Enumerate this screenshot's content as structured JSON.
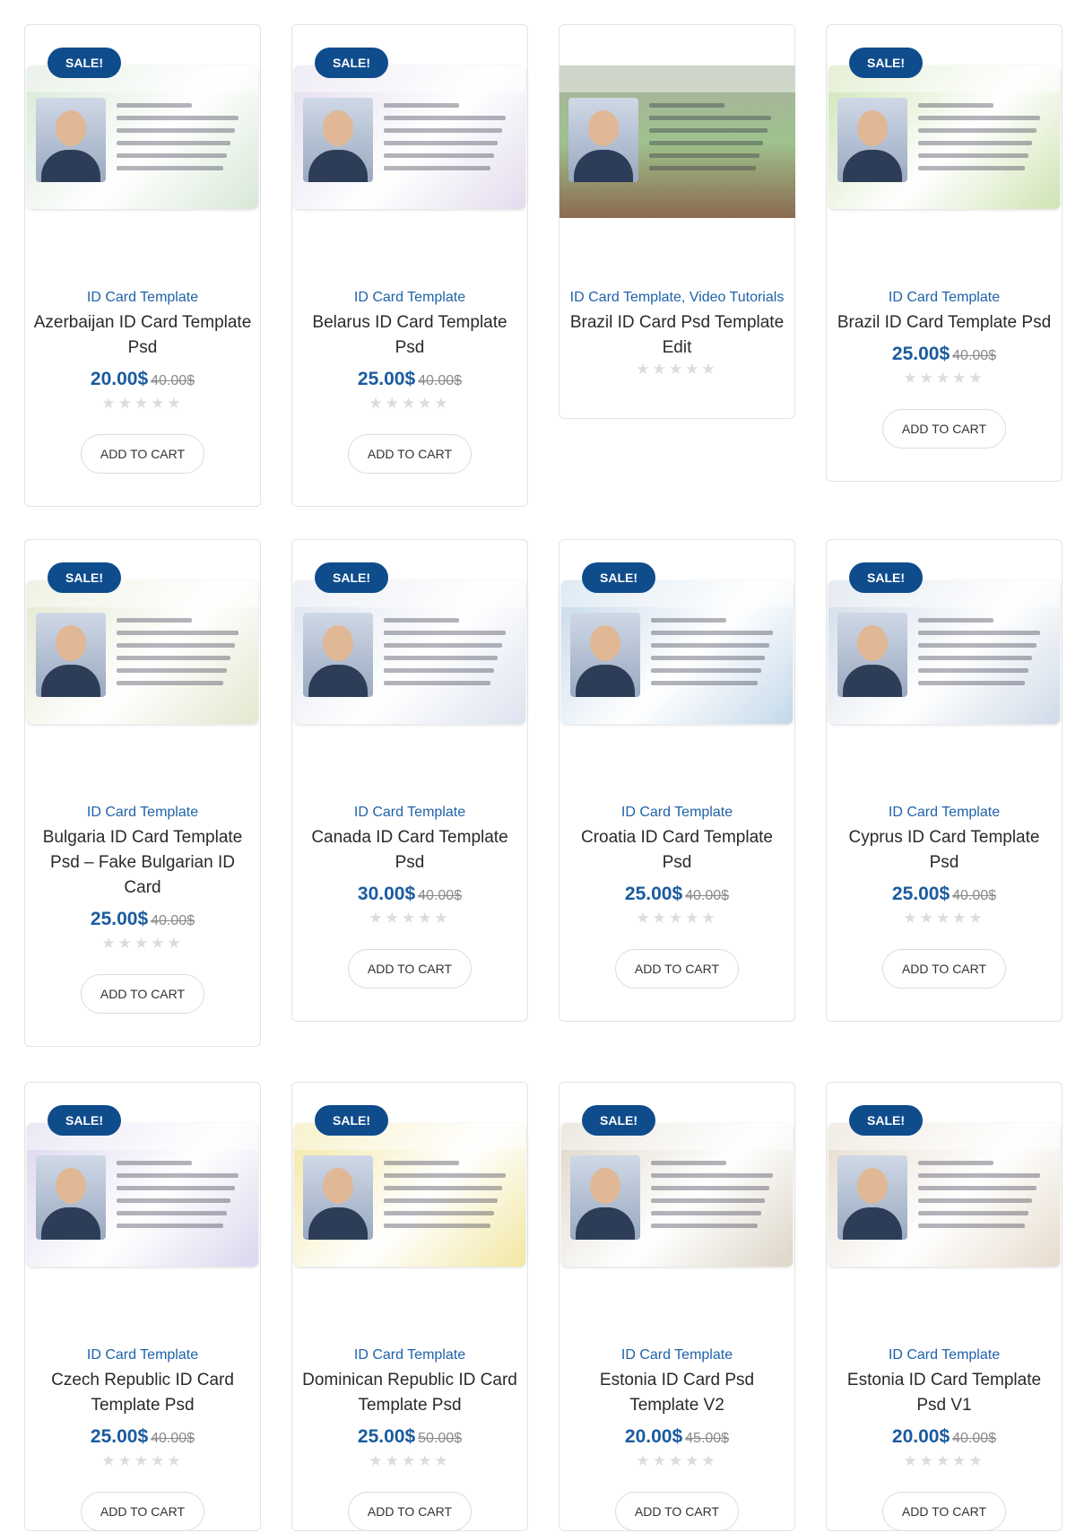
{
  "products": [
    {
      "sale": "SALE!",
      "image": "azerbaijan-id-card-image",
      "category": "ID Card Template",
      "title": "Azerbaijan ID Card Template Psd",
      "price": "20.00$",
      "old_price": "40.00$",
      "rating": 0,
      "button": "ADD TO CART",
      "tint": "#d7e8d6"
    },
    {
      "sale": "SALE!",
      "image": "belarus-id-card-image",
      "category": "ID Card Template",
      "title": "Belarus ID Card Template Psd",
      "price": "25.00$",
      "old_price": "40.00$",
      "rating": 0,
      "button": "ADD TO CART",
      "tint": "#e3dcee"
    },
    {
      "sale": "",
      "image": "brazil-id-card-photo-image",
      "category": "ID Card Template, Video Tutorials",
      "title": "Brazil ID Card Psd Template Edit",
      "price": "",
      "old_price": "",
      "rating": 0,
      "button": "",
      "tint": "#9fc28e"
    },
    {
      "sale": "SALE!",
      "image": "brazil-id-card-image",
      "category": "ID Card Template",
      "title": "Brazil ID Card Template Psd",
      "price": "25.00$",
      "old_price": "40.00$",
      "rating": 0,
      "button": "ADD TO CART",
      "tint": "#cfe4b3"
    },
    {
      "sale": "SALE!",
      "image": "bulgaria-id-card-image",
      "category": "ID Card Template",
      "title": "Bulgaria ID Card Template Psd – Fake Bulgarian ID Card",
      "price": "25.00$",
      "old_price": "40.00$",
      "rating": 0,
      "button": "ADD TO CART",
      "tint": "#e4e7cf"
    },
    {
      "sale": "SALE!",
      "image": "canada-id-card-image",
      "category": "ID Card Template",
      "title": "Canada ID Card Template Psd",
      "price": "30.00$",
      "old_price": "40.00$",
      "rating": 0,
      "button": "ADD TO CART",
      "tint": "#dde3ef"
    },
    {
      "sale": "SALE!",
      "image": "croatia-id-card-image",
      "category": "ID Card Template",
      "title": "Croatia ID Card Template Psd",
      "price": "25.00$",
      "old_price": "40.00$",
      "rating": 0,
      "button": "ADD TO CART",
      "tint": "#c3d8e9"
    },
    {
      "sale": "SALE!",
      "image": "cyprus-id-card-image",
      "category": "ID Card Template",
      "title": "Cyprus ID Card Template Psd",
      "price": "25.00$",
      "old_price": "40.00$",
      "rating": 0,
      "button": "ADD TO CART",
      "tint": "#d0dbe8"
    },
    {
      "sale": "SALE!",
      "image": "czech-id-card-image",
      "category": "ID Card Template",
      "title": "Czech Republic ID Card Template Psd",
      "price": "25.00$",
      "old_price": "40.00$",
      "rating": 0,
      "button": "ADD TO CART",
      "tint": "#dcd6ee"
    },
    {
      "sale": "SALE!",
      "image": "dominican-id-card-image",
      "category": "ID Card Template",
      "title": "Dominican Republic ID Card Template Psd",
      "price": "25.00$",
      "old_price": "50.00$",
      "rating": 0,
      "button": "ADD TO CART",
      "tint": "#f2e7a2"
    },
    {
      "sale": "SALE!",
      "image": "estonia-id-card-v2-image",
      "category": "ID Card Template",
      "title": "Estonia ID Card Psd Template V2",
      "price": "20.00$",
      "old_price": "45.00$",
      "rating": 0,
      "button": "ADD TO CART",
      "tint": "#ddd6c8"
    },
    {
      "sale": "SALE!",
      "image": "estonia-id-card-v1-image",
      "category": "ID Card Template",
      "title": "Estonia ID Card Template Psd V1",
      "price": "20.00$",
      "old_price": "40.00$",
      "rating": 0,
      "button": "ADD TO CART",
      "tint": "#e6dccd"
    }
  ],
  "star_glyphs": "★★★★★",
  "colors": {
    "sale_badge": "#0f4c8c",
    "category": "#1f62a8",
    "price": "#1a5b9e"
  }
}
